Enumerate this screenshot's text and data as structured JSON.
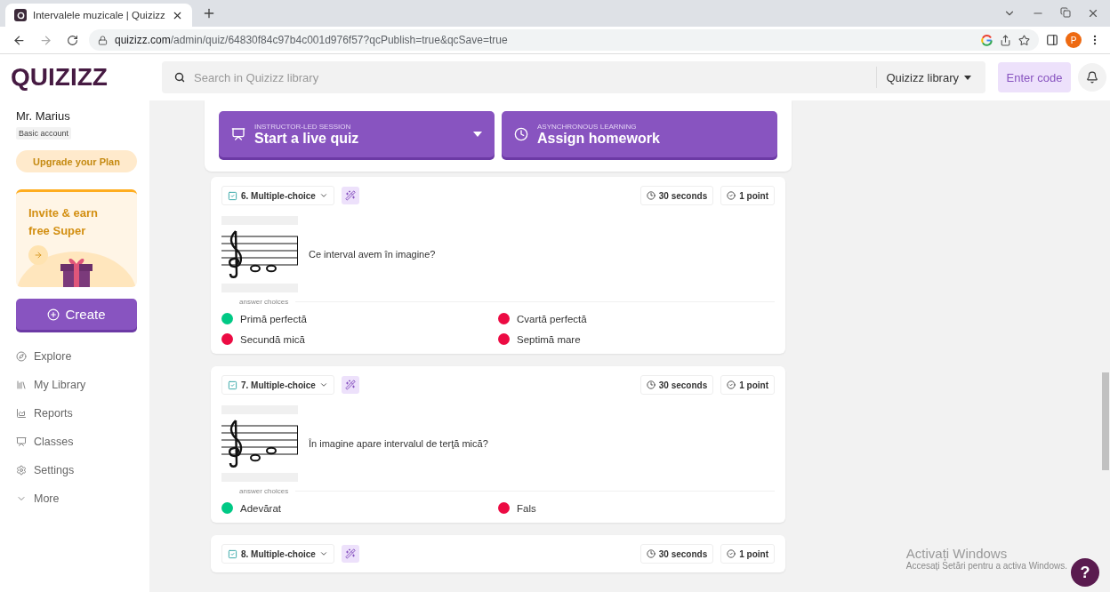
{
  "browser": {
    "tab_title": "Intervalele muzicale | Quizizz",
    "url_host": "quizizz.com",
    "url_path": "/admin/quiz/64830f84c97b4c001d976f57?qcPublish=true&qcSave=true",
    "avatar_letter": "P"
  },
  "header": {
    "logo": "QUIZIZZ",
    "search_placeholder": "Search in Quizizz library",
    "library_select": "Quizizz library",
    "enter_code": "Enter code"
  },
  "sidebar": {
    "user_name": "Mr. Marius",
    "plan": "Basic account",
    "upgrade": "Upgrade your Plan",
    "promo": "Invite & earn free Super",
    "create": "Create",
    "nav": [
      {
        "label": "Explore"
      },
      {
        "label": "My Library"
      },
      {
        "label": "Reports"
      },
      {
        "label": "Classes"
      },
      {
        "label": "Settings"
      },
      {
        "label": "More"
      }
    ]
  },
  "session_buttons": [
    {
      "kicker": "INSTRUCTOR-LED SESSION",
      "label": "Start a live quiz",
      "has_menu": true
    },
    {
      "kicker": "ASYNCHRONOUS LEARNING",
      "label": "Assign homework",
      "has_menu": false
    }
  ],
  "questions": [
    {
      "type_label": "6. Multiple-choice",
      "time": "30 seconds",
      "points": "1 point",
      "text": "Ce interval avem în imagine?",
      "choices_label": "answer choices",
      "choices": [
        {
          "text": "Primă perfectă",
          "correct": true
        },
        {
          "text": "Cvartă perfectă",
          "correct": false
        },
        {
          "text": "Secundă mică",
          "correct": false
        },
        {
          "text": "Septimă mare",
          "correct": false
        }
      ]
    },
    {
      "type_label": "7. Multiple-choice",
      "time": "30 seconds",
      "points": "1 point",
      "text": "În imagine apare intervalul de terţă mică?",
      "choices_label": "answer choices",
      "choices": [
        {
          "text": "Adevărat",
          "correct": true
        },
        {
          "text": "Fals",
          "correct": false
        }
      ]
    },
    {
      "type_label": "8. Multiple-choice",
      "time": "30 seconds",
      "points": "1 point"
    }
  ],
  "os_notice": {
    "title": "Activați Windows",
    "subtitle": "Accesați Setări pentru a activa Windows."
  },
  "help": "?"
}
